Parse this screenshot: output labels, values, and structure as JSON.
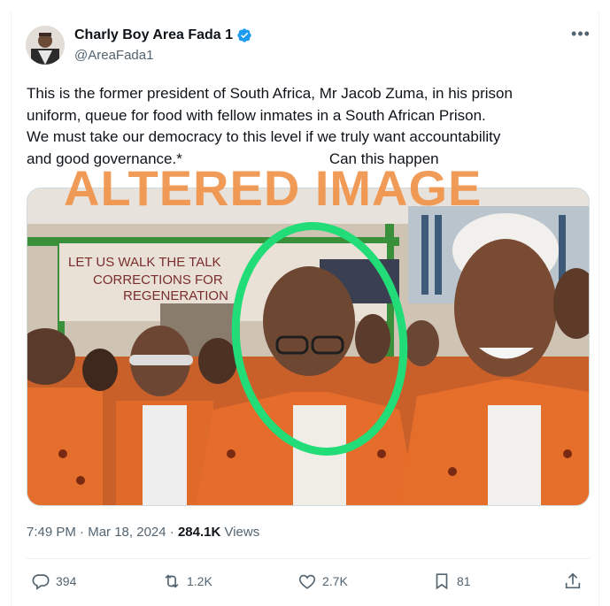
{
  "author": {
    "display_name": "Charly Boy Area Fada 1",
    "handle": "@AreaFada1",
    "verified_icon": "verified-badge-icon",
    "badge_color": "#1d9bf0"
  },
  "more_label": "•••",
  "tweet": {
    "lines": [
      "This is the former president of South Africa, Mr Jacob Zuma, in his prison",
      "uniform, queue for food with fellow inmates in a South African Prison.",
      "We must take our democracy to this level if we truly want accountability"
    ],
    "last_line": "and good governance.*",
    "tail": "Can this happen"
  },
  "media": {
    "banner_text_1": "LET US WALK THE TALK",
    "banner_text_2": "CORRECTIONS FOR",
    "banner_text_3": "REGENERATION",
    "watermark": "ALTERED IMAGE",
    "watermark_color": "#f0934a",
    "highlight_color": "#22dd77"
  },
  "meta": {
    "time": "7:49 PM",
    "sep1": " · ",
    "date": "Mar 18, 2024",
    "sep2": " · ",
    "views_count": "284.1K",
    "views_label": " Views"
  },
  "actions": {
    "replies": "394",
    "reposts": "1.2K",
    "likes": "2.7K",
    "bookmarks": "81"
  }
}
